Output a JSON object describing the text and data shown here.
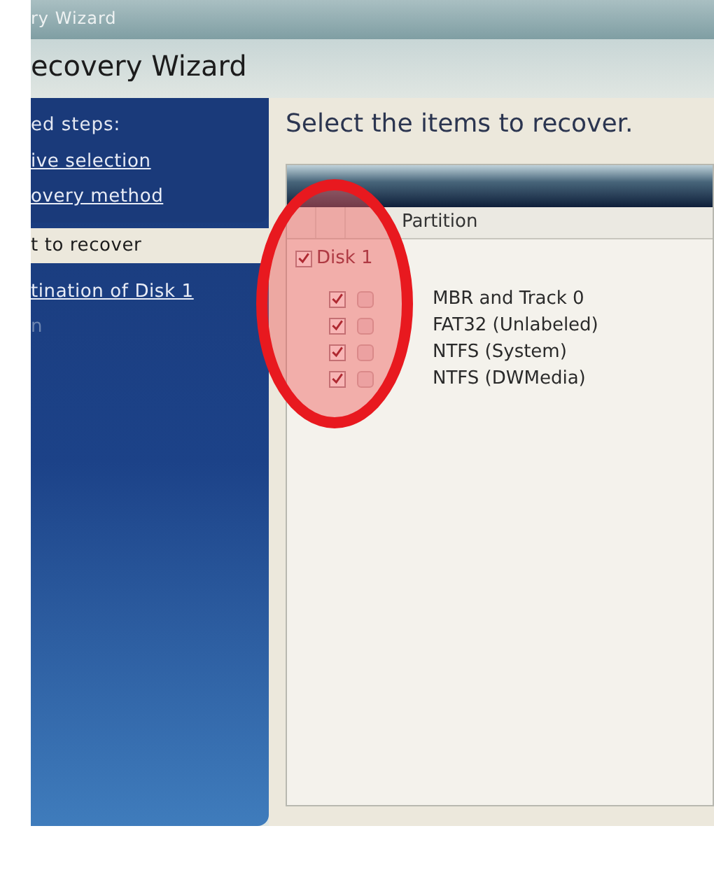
{
  "window": {
    "title": "ry Wizard"
  },
  "header": {
    "title": "ecovery Wizard"
  },
  "sidebar": {
    "heading": "ed steps:",
    "items": [
      {
        "label": "ive selection",
        "kind": "link"
      },
      {
        "label": "overy method",
        "kind": "link"
      },
      {
        "label": "t to recover",
        "kind": "current"
      },
      {
        "label": "tination of Disk 1",
        "kind": "link"
      },
      {
        "label": "n",
        "kind": "pending"
      }
    ]
  },
  "content": {
    "title": "Select the items to recover.",
    "table": {
      "columns": [
        "Partition"
      ],
      "disk": {
        "label": "Disk 1",
        "checked": true,
        "partitions": [
          {
            "name": "MBR and Track 0",
            "checked": true,
            "second_checked": false
          },
          {
            "name": "FAT32 (Unlabeled)",
            "checked": true,
            "second_checked": false
          },
          {
            "name": "NTFS (System)",
            "checked": true,
            "second_checked": false
          },
          {
            "name": "NTFS (DWMedia)",
            "checked": true,
            "second_checked": false
          }
        ]
      }
    }
  },
  "highlight_circle": true
}
